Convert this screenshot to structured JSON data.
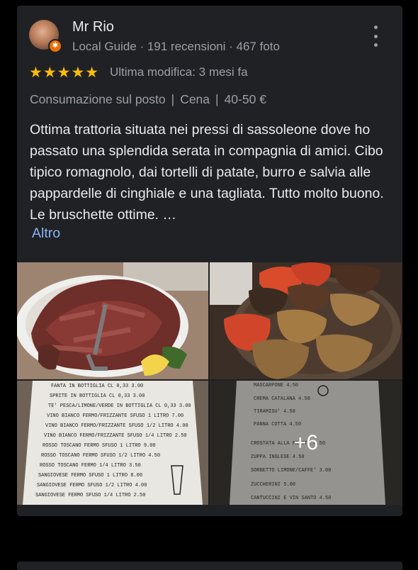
{
  "review": {
    "author": "Mr Rio",
    "subline": "Local Guide · 191 recensioni · 467 foto",
    "rating_stars": 5,
    "stars_text": "★★★★★",
    "modified": "Ultima modifica: 3 mesi fa",
    "meta": [
      "Consumazione sul posto",
      "Cena",
      "40-50 €"
    ],
    "text": "Ottima trattoria situata nei pressi di sassoleone dove ho passato una splendida serata in compagnia di amici. Cibo tipico romagnolo, dai tortelli di patate, burro e salvia alle pappardelle di cinghiale e una tagliata. Tutto molto buono. Le bruschette ottime. …",
    "more_label": "Altro"
  },
  "photos": {
    "more_count_label": "+6",
    "menu_drinks": [
      "FANTA IN BOTTIGLIA CL 0,33   3.00",
      "SPRITE IN BOTTIGLIA CL 0,33   3.00",
      "TE' PESCA/LIMONE/VERDE IN BOTTIGLIA CL 0,33   3.00",
      "VINO BIANCO FERMO/FRIZZANTE SFUSO 1 LITRO   7.00",
      "VINO BIANCO FERMO/FRIZZANTE SFUSO 1/2 LITRO   4.00",
      "VINO BIANCO FERMO/FRIZZANTE SFUSO 1/4 LITRO   2.50",
      "ROSSO TOSCANO FERMO SFUSO 1 LITRO   9.00",
      "ROSSO TOSCANO FERMO SFUSO 1/2 LITRO   4.50",
      "ROSSO TOSCANO FERMO 1/4 LITRO   3.50",
      "SANGIOVESE FERMO SFUSO 1 LITRO   8.00",
      "SANGIOVESE FERMO SFUSO 1/2 LITRO   4.00",
      "SANGIOVESE FERMO SFUSO 1/4 LITRO   2.50"
    ],
    "menu_desserts": [
      "MASCARPONE   4.50",
      "CREMA CATALANA   4.50",
      "TIRAMISU'   4.50",
      "PANNA COTTA   4.50",
      "CROSTATA ALLA FRUTTA   4.50",
      "ZUPPA INGLESE   4.50",
      "SORBETTO LIMONE/CAFFE'   3.00",
      "ZUCCHERINI   5.00",
      "CANTUCCINI E VIN SANTO   4.50"
    ]
  },
  "icons": {
    "more": "more-vert-icon",
    "star": "star-icon",
    "badge": "local-guide-badge-icon"
  },
  "colors": {
    "card": "#202124",
    "star": "#fbbc04",
    "link": "#8ab4f8",
    "badge": "#e8710a"
  }
}
